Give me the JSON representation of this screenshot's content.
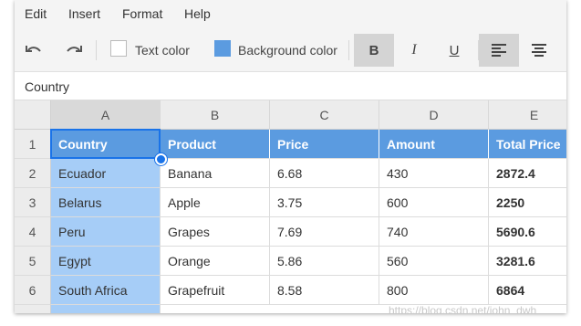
{
  "menu": [
    {
      "label": "Edit"
    },
    {
      "label": "Insert"
    },
    {
      "label": "Format"
    },
    {
      "label": "Help"
    }
  ],
  "toolbar": {
    "undo_icon": "undo-icon",
    "redo_icon": "redo-icon",
    "text_color_label": "Text color",
    "text_color_value": "#ffffff",
    "background_color_label": "Background color",
    "background_color_value": "#5b9be0",
    "bold_label": "B",
    "italic_label": "I",
    "underline_label": "U",
    "align_left_icon": "align-left-icon",
    "align_center_icon": "align-center-icon",
    "bold_active": true,
    "align_left_active": true
  },
  "formula_bar": {
    "value": "Country"
  },
  "columns": [
    "A",
    "B",
    "C",
    "D",
    "E"
  ],
  "selected_column": "A",
  "rows": [
    {
      "num": "1",
      "cells": [
        "Country",
        "Product",
        "Price",
        "Amount",
        "Total Price"
      ]
    },
    {
      "num": "2",
      "cells": [
        "Ecuador",
        "Banana",
        "6.68",
        "430",
        "2872.4"
      ]
    },
    {
      "num": "3",
      "cells": [
        "Belarus",
        "Apple",
        "3.75",
        "600",
        "2250"
      ]
    },
    {
      "num": "4",
      "cells": [
        "Peru",
        "Grapes",
        "7.69",
        "740",
        "5690.6"
      ]
    },
    {
      "num": "5",
      "cells": [
        "Egypt",
        "Orange",
        "5.86",
        "560",
        "3281.6"
      ]
    },
    {
      "num": "6",
      "cells": [
        "South Africa",
        "Grapefruit",
        "8.58",
        "800",
        "6864"
      ]
    }
  ],
  "colors": {
    "header_fill": "#5b9be0",
    "selected_column_fill": "#a6cdf7",
    "selection_border": "#1a73e8"
  },
  "watermark": "https://blog.csdn.net/john_dwh"
}
